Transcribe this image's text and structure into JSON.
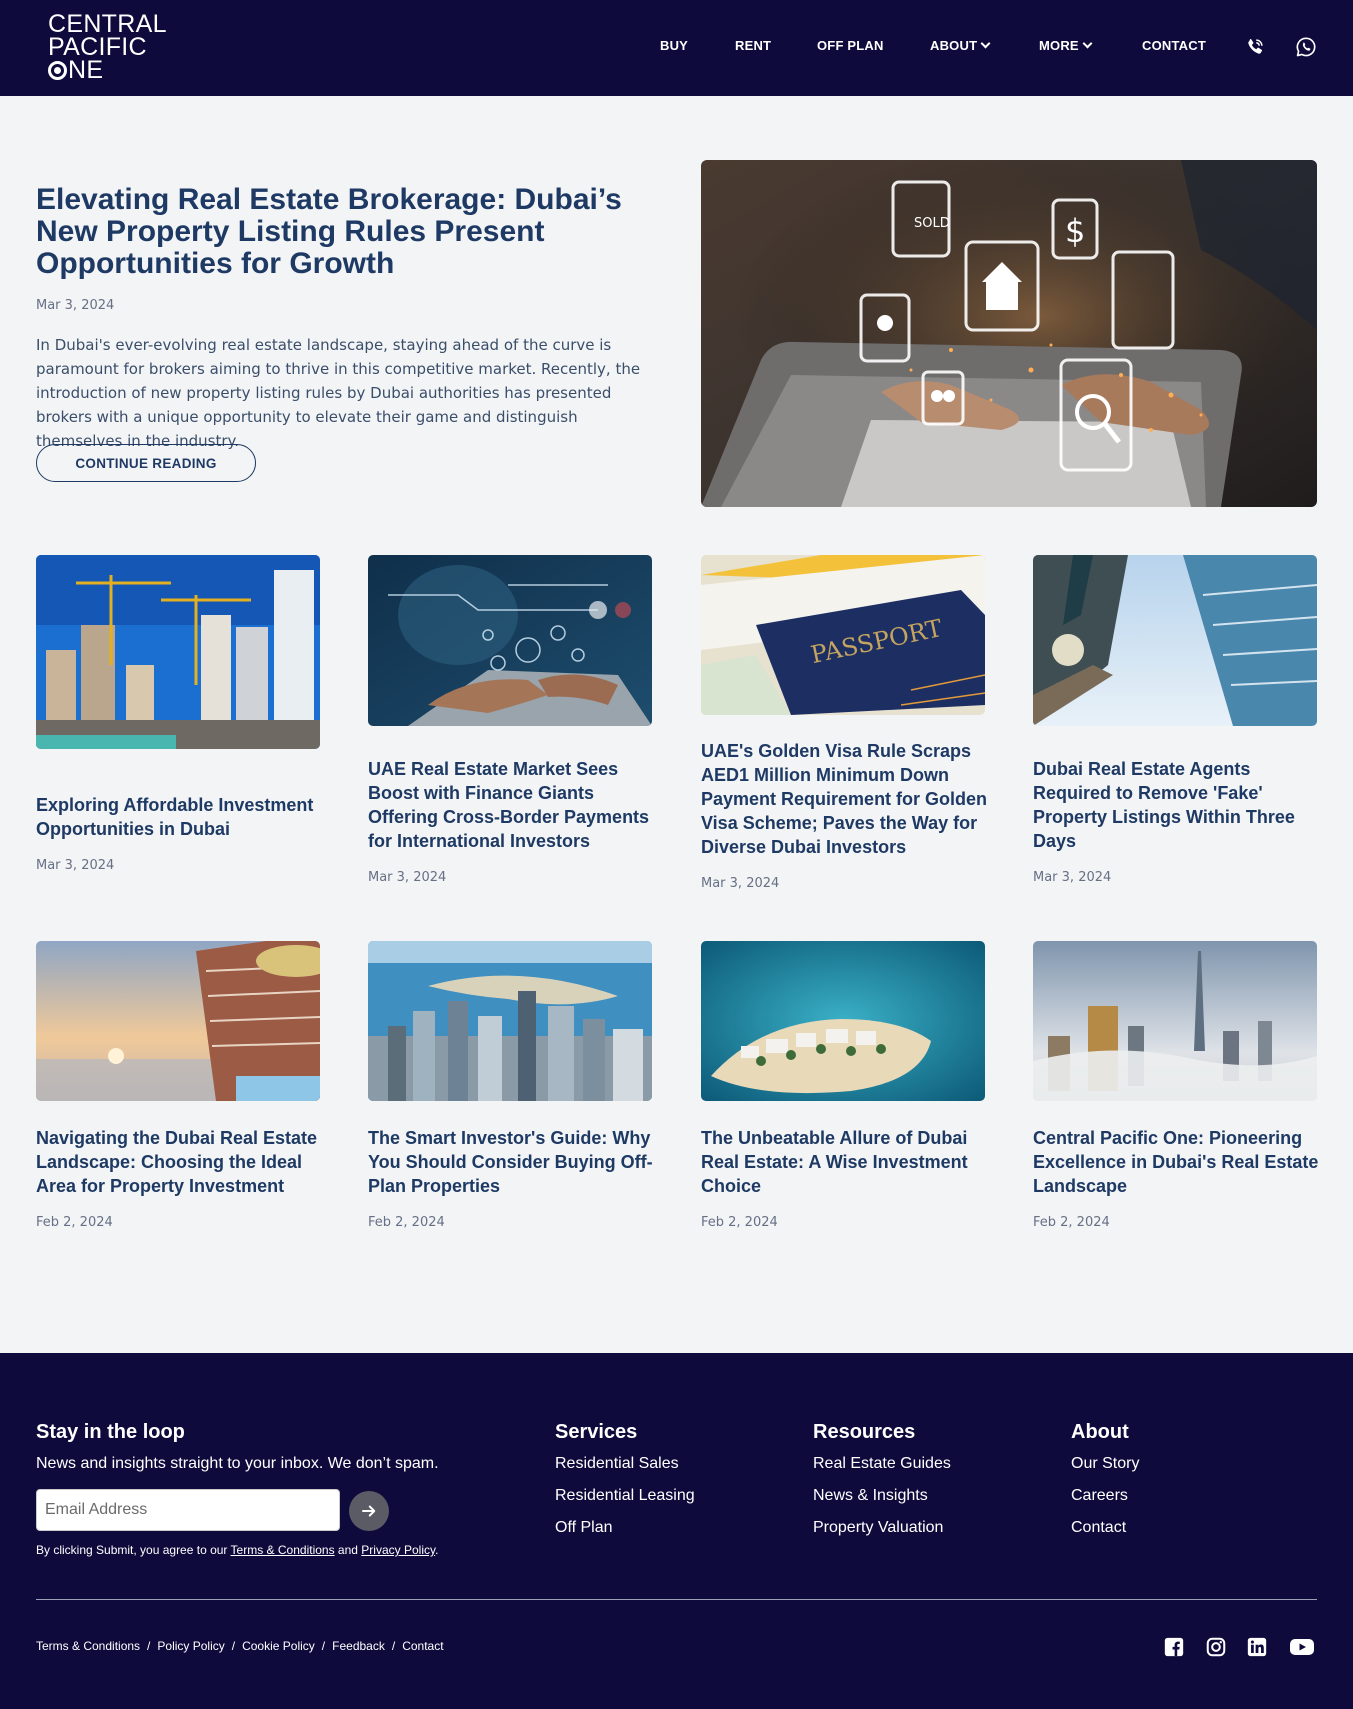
{
  "brand": {
    "logo_line1": "CENTRAL",
    "logo_line2": "PACIFIC",
    "logo_line3": "NE",
    "colors": {
      "navy": "#0e0b3c",
      "heading": "#1e3a64",
      "background": "#f3f4f6"
    }
  },
  "nav": {
    "items": [
      {
        "label": "BUY"
      },
      {
        "label": "RENT"
      },
      {
        "label": "OFF PLAN"
      },
      {
        "label": "ABOUT",
        "dropdown": true
      },
      {
        "label": "MORE",
        "dropdown": true
      },
      {
        "label": "CONTACT"
      }
    ],
    "icons": [
      "phone-icon",
      "whatsapp-icon"
    ]
  },
  "featured": {
    "title": "Elevating Real Estate Brokerage: Dubai’s New Property Listing Rules Present Opportunities for Growth",
    "date": "Mar 3, 2024",
    "excerpt": "In Dubai's ever-evolving real estate landscape, staying ahead of the curve is paramount for brokers aiming to thrive in this competitive market. Recently, the introduction of new property listing rules by Dubai authorities has presented brokers with a unique opportunity to elevate their game and distinguish themselves in the industry.",
    "cta": "CONTINUE READING",
    "image": "laptop-real-estate-icons-image"
  },
  "articles": [
    {
      "title": "Exploring Affordable Investment Opportunities in Dubai",
      "date": "Mar 3, 2024",
      "image": "construction-cranes-image"
    },
    {
      "title": "UAE Real Estate Market Sees Boost with Finance Giants Offering Cross-Border Payments for International Investors",
      "date": "Mar 3, 2024",
      "image": "laptop-security-image"
    },
    {
      "title": "UAE's Golden Visa Rule Scraps AED1 Million Minimum Down Payment Requirement for Golden Visa Scheme; Paves the Way for Diverse Dubai Investors",
      "date": "Mar 3, 2024",
      "image": "passport-image"
    },
    {
      "title": "Dubai Real Estate Agents Required to Remove 'Fake' Property Listings Within Three Days",
      "date": "Mar 3, 2024",
      "image": "skyscrapers-sky-image"
    },
    {
      "title": "Navigating the Dubai Real Estate Landscape: Choosing the Ideal Area for Property Investment",
      "date": "Feb 2, 2024",
      "image": "hotel-terrace-sunset-image"
    },
    {
      "title": "The Smart Investor's Guide: Why You Should Consider Buying Off-Plan Properties",
      "date": "Feb 2, 2024",
      "image": "dubai-marina-palm-image"
    },
    {
      "title": "The Unbeatable Allure of Dubai Real Estate: A Wise Investment Choice",
      "date": "Feb 2, 2024",
      "image": "island-villas-image"
    },
    {
      "title": "Central Pacific One: Pioneering Excellence in Dubai's Real Estate Landscape",
      "date": "Feb 2, 2024",
      "image": "downtown-fog-skyline-image"
    }
  ],
  "footer": {
    "newsletter_title": "Stay in the loop",
    "newsletter_sub": "News and insights straight to your inbox. We don’t spam.",
    "email_placeholder": "Email Address",
    "legal_prefix": "By clicking Submit, you agree to our ",
    "legal_terms": "Terms & Conditions",
    "legal_and": " and ",
    "legal_privacy": "Privacy Policy",
    "legal_suffix": ".",
    "columns": [
      {
        "title": "Services",
        "links": [
          "Residential Sales",
          "Residential Leasing",
          "Off Plan"
        ]
      },
      {
        "title": "Resources",
        "links": [
          "Real Estate Guides",
          "News & Insights",
          "Property Valuation"
        ]
      },
      {
        "title": "About",
        "links": [
          "Our Story",
          "Careers",
          "Contact"
        ]
      }
    ],
    "bottom_links": [
      "Terms & Conditions",
      "Policy Policy",
      "Cookie Policy",
      "Feedback",
      "Contact"
    ],
    "bottom_separator": "/",
    "social": [
      "facebook-icon",
      "instagram-icon",
      "linkedin-icon",
      "youtube-icon"
    ]
  }
}
